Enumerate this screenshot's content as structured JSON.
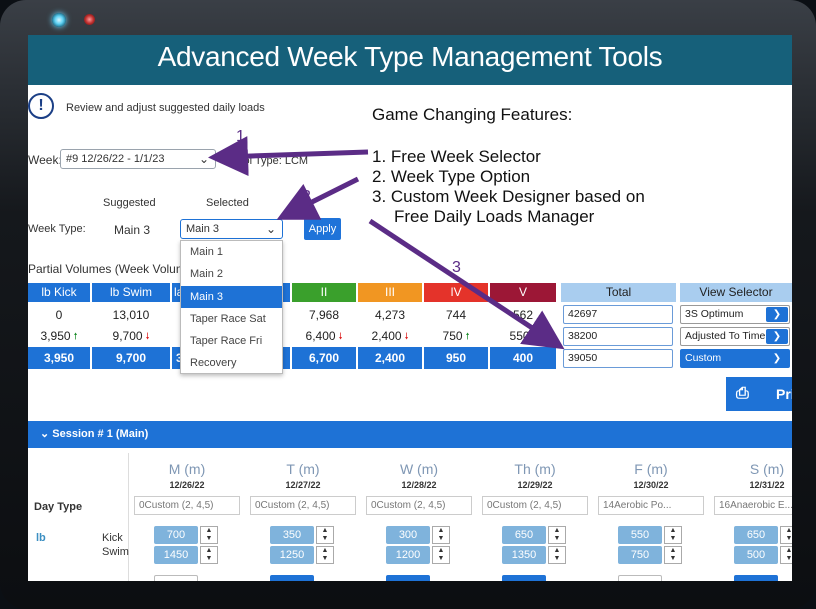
{
  "title": "Advanced Week Type Management Tools",
  "info_text": "Review and adjust suggested daily loads",
  "week_label": "Week:",
  "week_value": "#9 12/26/22 - 1/1/23",
  "pool_type": "Pool Type: LCM",
  "suggested_label": "Suggested",
  "selected_label": "Selected",
  "week_type_label": "Week Type:",
  "suggested_value": "Main 3",
  "selected_value": "Main 3",
  "apply_label": "Apply",
  "partial_label": "Partial Volumes (Week Volume",
  "partial_tail": ")",
  "dropdown": [
    "Main 1",
    "Main 2",
    "Main 3",
    "Taper Race Sat",
    "Taper Race Fri",
    "Recovery"
  ],
  "features": {
    "heading": "Game Changing Features:",
    "items": [
      "1. Free Week Selector",
      "2. Week Type Option",
      "3. Custom Week Designer based on",
      "Free Daily Loads Manager"
    ]
  },
  "markers": [
    "1",
    "2",
    "3"
  ],
  "table": {
    "headers": [
      "lb Kick",
      "lb Swim",
      "la",
      "II",
      "III",
      "IV",
      "V",
      "Total",
      "View Selector"
    ],
    "row1": [
      "0",
      "13,010",
      "7,968",
      "4,273",
      "744",
      "562"
    ],
    "row2": [
      "3,950",
      "9,700",
      "6,400",
      "2,400",
      "750",
      "550"
    ],
    "row3": [
      "3,950",
      "9,700",
      "3",
      "6,700",
      "2,400",
      "950",
      "400"
    ],
    "totals": [
      "42697",
      "38200",
      "39050"
    ],
    "view": [
      "3S Optimum",
      "Adjusted To Time",
      "Custom"
    ]
  },
  "print_label": "Pri",
  "session_label": "Session # 1 (Main)",
  "days": [
    {
      "d": "M (m)",
      "date": "12/26/22",
      "type": "0Custom (2, 4,5)",
      "k": "700",
      "s": "1450"
    },
    {
      "d": "T (m)",
      "date": "12/27/22",
      "type": "0Custom (2, 4,5)",
      "k": "350",
      "s": "1250"
    },
    {
      "d": "W (m)",
      "date": "12/28/22",
      "type": "0Custom (2, 4,5)",
      "k": "300",
      "s": "1200"
    },
    {
      "d": "Th (m)",
      "date": "12/29/22",
      "type": "0Custom (2, 4,5)",
      "k": "650",
      "s": "1350"
    },
    {
      "d": "F (m)",
      "date": "12/30/22",
      "type": "14Aerobic Po...",
      "k": "550",
      "s": "750"
    },
    {
      "d": "S (m)",
      "date": "12/31/22",
      "type": "16Anaerobic E...",
      "k": "650",
      "s": "500"
    }
  ],
  "day_type_label": "Day Type",
  "lb_label": "lb",
  "kick_label": "Kick",
  "swim_label": "Swim",
  "colors": {
    "accent": "#1e72d6",
    "title_bar": "#16607a",
    "arrow": "#5b2c86"
  }
}
